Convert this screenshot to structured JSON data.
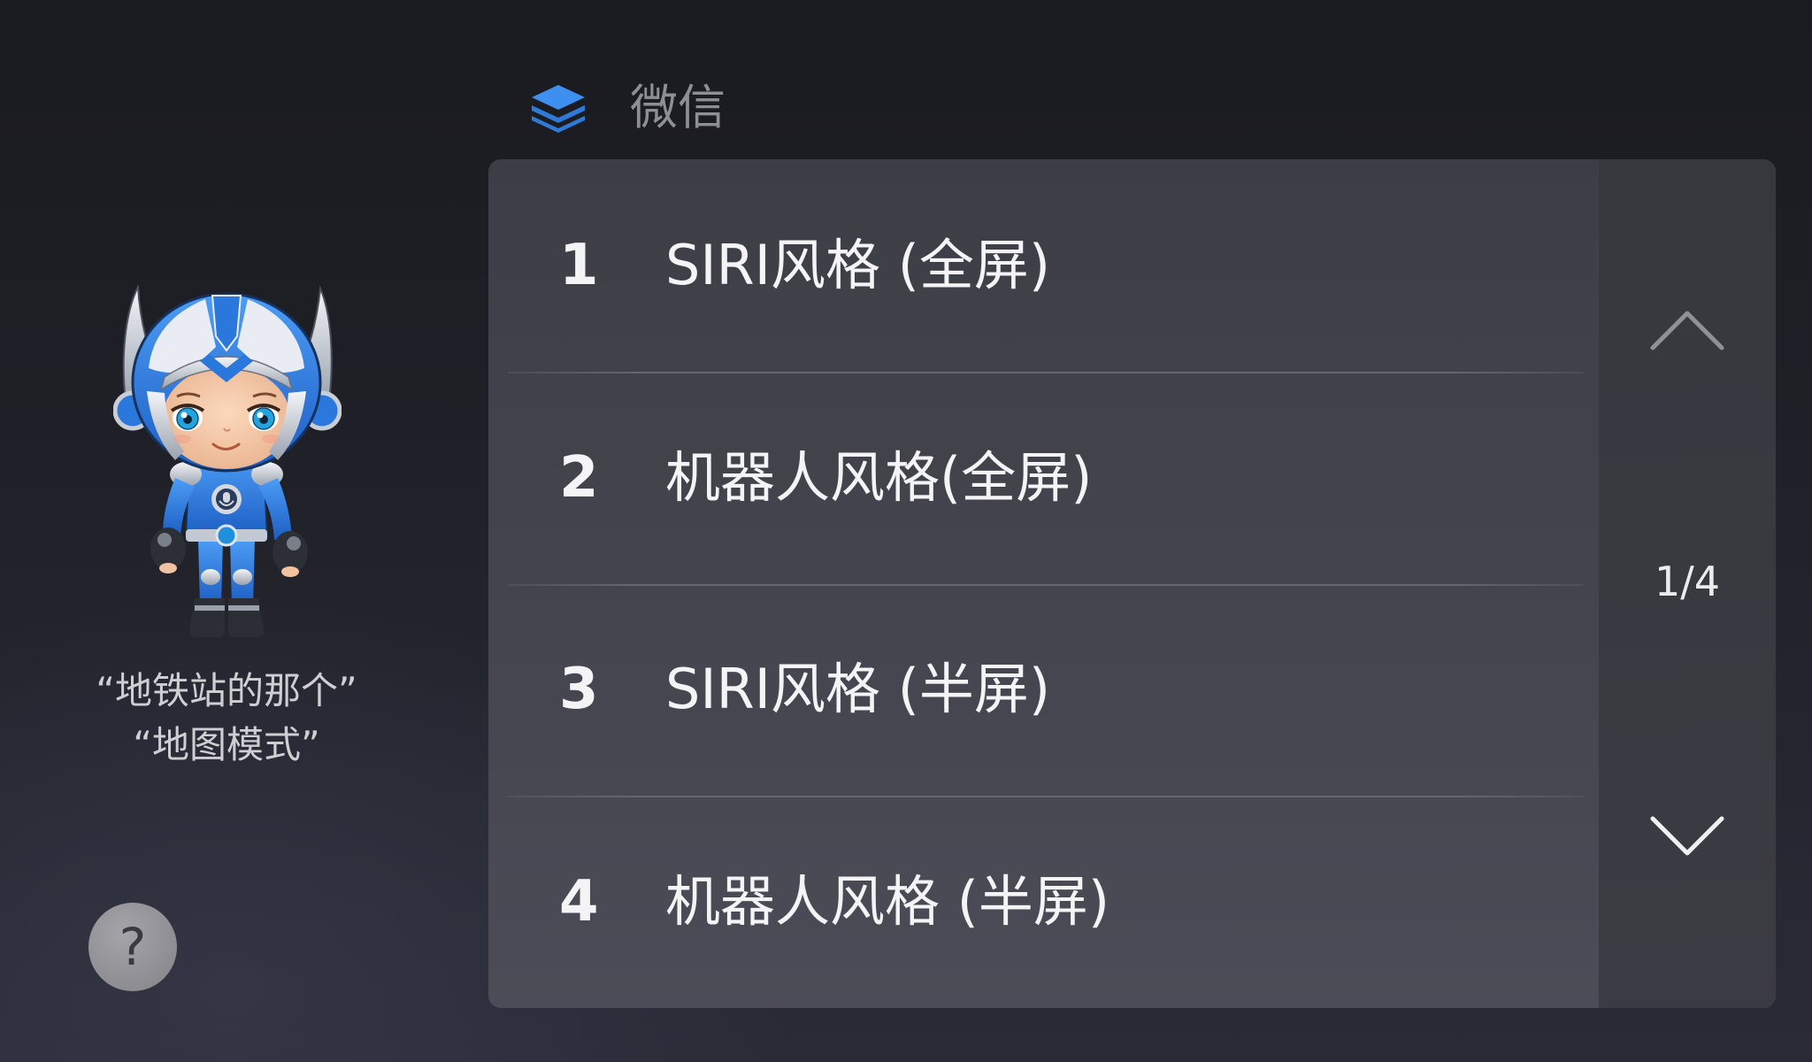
{
  "header": {
    "icon": "layers-icon",
    "title": "微信"
  },
  "assistant": {
    "avatar_icon": "robot-mascot",
    "hints": [
      "“地铁站的那个”",
      "“地图模式”"
    ],
    "help_label": "?"
  },
  "options": [
    {
      "number": "1",
      "label": "SIRI风格 (全屏)"
    },
    {
      "number": "2",
      "label": "机器人风格(全屏)"
    },
    {
      "number": "3",
      "label": "SIRI风格 (半屏)"
    },
    {
      "number": "4",
      "label": "机器人风格 (半屏)"
    }
  ],
  "pager": {
    "up_icon": "chevron-up-icon",
    "down_icon": "chevron-down-icon",
    "page_indicator": "1/4"
  },
  "colors": {
    "background": "#1c1d23",
    "panel": "#42434b",
    "pager": "#393a40",
    "accent": "#3d8ff0",
    "text": "#f4f4f6",
    "muted": "#8e8f94"
  }
}
